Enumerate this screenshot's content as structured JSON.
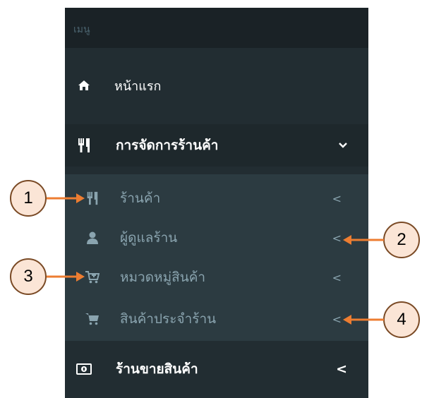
{
  "menu": {
    "header": "เมนู",
    "home": "หน้าแรก",
    "manage": "การจัดการร้านค้า",
    "manage_caret": "⌄",
    "submenu": [
      {
        "label": "ร้านค้า",
        "caret": "<"
      },
      {
        "label": "ผู้ดูแลร้าน",
        "caret": "<"
      },
      {
        "label": "หมวดหมู่สินค้า",
        "caret": "<"
      },
      {
        "label": "สินค้าประจำร้าน",
        "caret": "<"
      }
    ],
    "shop": "ร้านขายสินค้า",
    "shop_caret": "<"
  },
  "callouts": [
    "1",
    "2",
    "3",
    "4"
  ],
  "colors": {
    "sidebar_bg": "#222d32",
    "submenu_bg": "#2c3b41",
    "callout_fill": "#fbe5d6",
    "arrow": "#ed7d31"
  },
  "icons": [
    "home-icon",
    "utensils-icon",
    "user-icon",
    "cart-plus-icon",
    "cart-icon",
    "money-icon"
  ]
}
